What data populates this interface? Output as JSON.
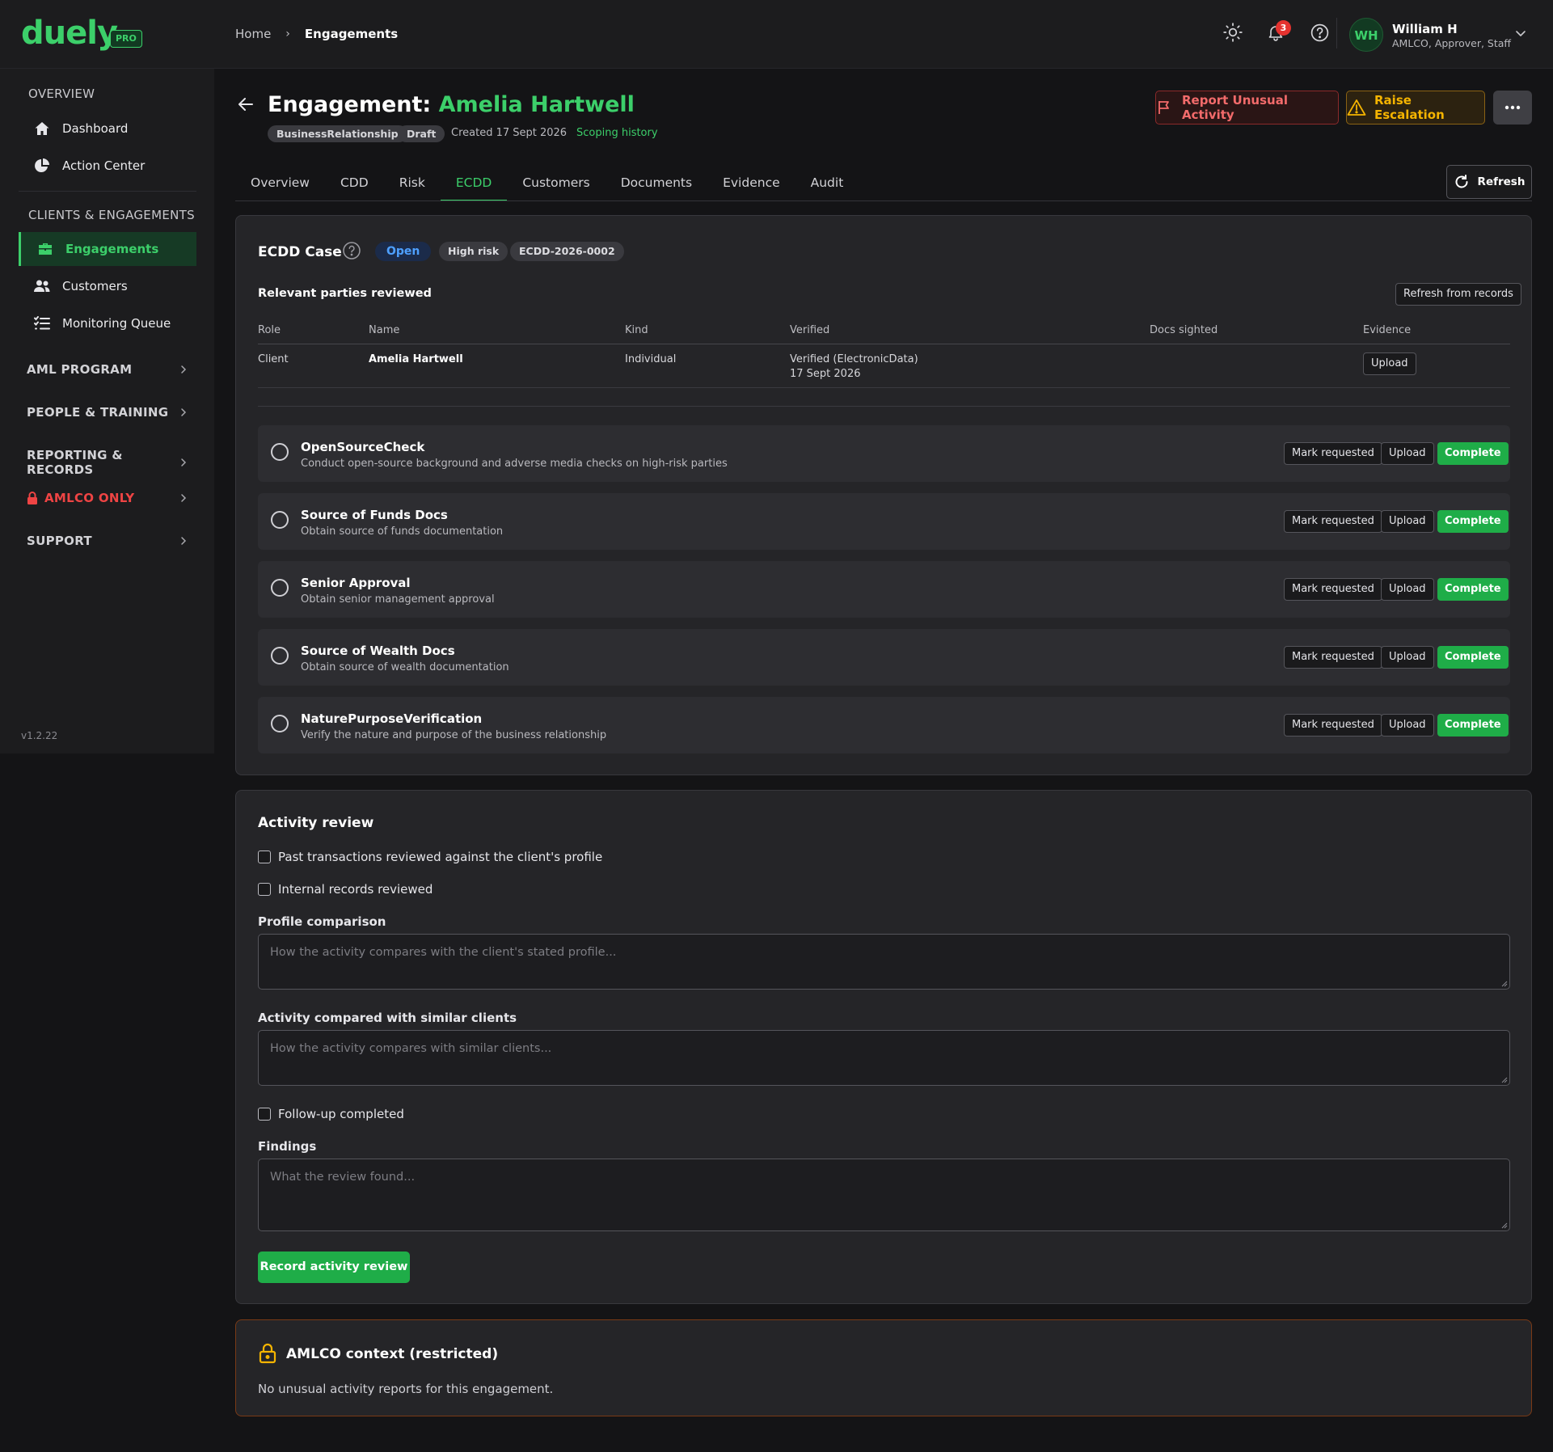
{
  "brand": {
    "name": "duely",
    "badge": "PRO",
    "accent": "#3ccf6a"
  },
  "breadcrumb": {
    "home": "Home",
    "separator": "›",
    "current": "Engagements"
  },
  "topbar": {
    "icons": [
      "sun-icon",
      "bell-icon",
      "help-icon"
    ],
    "notification_count": "3",
    "user": {
      "initials": "WH",
      "name": "William H",
      "roles": "AMLCO, Approver, Staff"
    }
  },
  "sidebar": {
    "sections": [
      {
        "title": "OVERVIEW",
        "items": [
          {
            "label": "Dashboard",
            "icon": "home-icon"
          },
          {
            "label": "Action Center",
            "icon": "pie-chart-icon"
          }
        ]
      },
      {
        "title": "CLIENTS & ENGAGEMENTS",
        "items": [
          {
            "label": "Engagements",
            "icon": "briefcase-icon",
            "active": true
          },
          {
            "label": "Customers",
            "icon": "users-icon"
          },
          {
            "label": "Monitoring Queue",
            "icon": "list-check-icon"
          }
        ]
      }
    ],
    "groups": [
      {
        "label": "AML PROGRAM"
      },
      {
        "label": "PEOPLE & TRAINING"
      },
      {
        "label": "REPORTING & RECORDS"
      },
      {
        "label": "AMLCO ONLY",
        "color": "#ef4444",
        "icon": "lock-icon"
      },
      {
        "label": "SUPPORT"
      }
    ],
    "version": "v1.2.22"
  },
  "page": {
    "title_prefix": "Engagement:",
    "client_name": "Amelia Hartwell",
    "tags": [
      "BusinessRelationship",
      "Draft"
    ],
    "created": "Created 17 Sept 2026",
    "dot": "·",
    "scoping_link": "Scoping history",
    "actions": {
      "report": "Report Unusual Activity",
      "escalate": "Raise Escalation",
      "more": "more-icon"
    }
  },
  "tabs": [
    "Overview",
    "CDD",
    "Risk",
    "ECDD",
    "Customers",
    "Documents",
    "Evidence",
    "Audit"
  ],
  "active_tab": "ECDD",
  "refresh_label": "Refresh",
  "ecdd": {
    "title": "ECDD Case",
    "status": "Open",
    "risk": "High risk",
    "case_id": "ECDD-2026-0002",
    "parties_heading": "Relevant parties reviewed",
    "refresh_records": "Refresh from records",
    "columns": [
      "Role",
      "Name",
      "Kind",
      "Verified",
      "Docs sighted",
      "Evidence"
    ],
    "rows": [
      {
        "role": "Client",
        "name": "Amelia Hartwell",
        "kind": "Individual",
        "verified": "Verified (ElectronicData)",
        "verified_date": "17 Sept 2026",
        "docs_sighted": "",
        "evidence_button": "Upload"
      }
    ],
    "task_buttons": {
      "mark": "Mark requested",
      "upload": "Upload",
      "complete": "Complete"
    },
    "tasks": [
      {
        "title": "OpenSourceCheck",
        "desc": "Conduct open-source background and adverse media checks on high-risk parties"
      },
      {
        "title": "Source of Funds Docs",
        "desc": "Obtain source of funds documentation"
      },
      {
        "title": "Senior Approval",
        "desc": "Obtain senior management approval"
      },
      {
        "title": "Source of Wealth Docs",
        "desc": "Obtain source of wealth documentation"
      },
      {
        "title": "NaturePurposeVerification",
        "desc": "Verify the nature and purpose of the business relationship"
      }
    ]
  },
  "activity_review": {
    "title": "Activity review",
    "checks": [
      "Past transactions reviewed against the client's profile",
      "Internal records reviewed"
    ],
    "profile_label": "Profile comparison",
    "profile_placeholder": "How the activity compares with the client's stated profile...",
    "similar_label": "Activity compared with similar clients",
    "similar_placeholder": "How the activity compares with similar clients...",
    "followup": "Follow-up completed",
    "findings_label": "Findings",
    "findings_placeholder": "What the review found...",
    "submit": "Record activity review"
  },
  "amlco_context": {
    "title": "AMLCO context (restricted)",
    "message": "No unusual activity reports for this engagement.",
    "accent": "#f5b400"
  }
}
